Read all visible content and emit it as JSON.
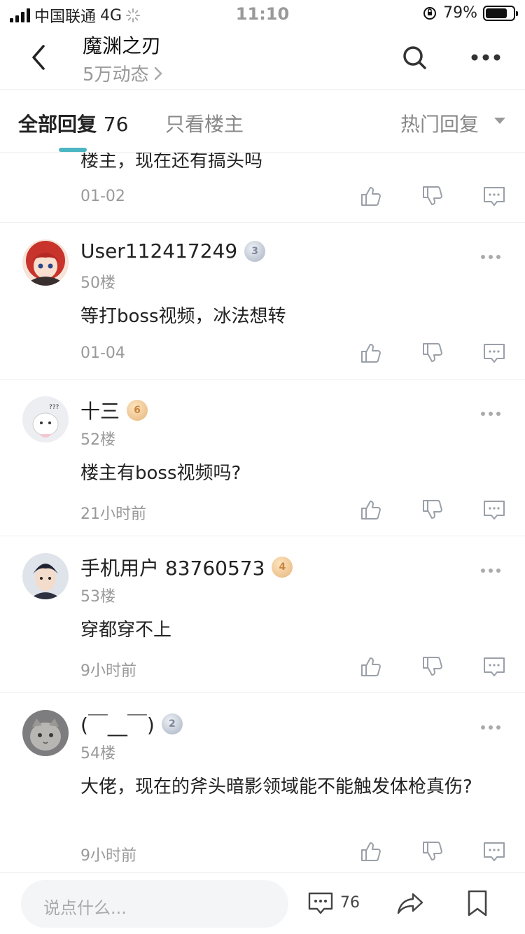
{
  "status_bar": {
    "carrier": "中国联通",
    "network": "4G",
    "time": "11:10",
    "battery": "79%",
    "battery_level": 0.79
  },
  "header": {
    "title": "魔渊之刃",
    "subtitle": "5万动态",
    "icons": [
      "back-icon",
      "search-icon",
      "more-icon"
    ]
  },
  "tabs": {
    "all_label": "全部回复",
    "all_count": "76",
    "owner_label": "只看楼主",
    "sort_label": "热门回复"
  },
  "posts": [
    {
      "content": "楼主，现在还有搞头吗",
      "time": "01-02"
    },
    {
      "username": "User112417249",
      "badge_level": "3",
      "badge_color": "#a8b2c2",
      "floor": "50楼",
      "content": "等打boss视频，冰法想转",
      "time": "01-04"
    },
    {
      "username": "十三",
      "badge_level": "6",
      "badge_color": "#e6b47a",
      "floor": "52楼",
      "content": "楼主有boss视频吗?",
      "time": "21小时前"
    },
    {
      "username": "手机用户 83760573",
      "badge_level": "4",
      "badge_color": "#e6b47a",
      "floor": "53楼",
      "content": "穿都穿不上",
      "time": "9小时前"
    },
    {
      "username": "(￣__￣)",
      "badge_level": "2",
      "badge_color": "#a8b2c2",
      "floor": "54楼",
      "content": "大佬，现在的斧头暗影领域能不能触发体枪真伤?",
      "time": "9小时前"
    }
  ],
  "bottom_bar": {
    "input_placeholder": "说点什么...",
    "comment_count": "76",
    "icons": [
      "comment-icon",
      "share-icon",
      "bookmark-icon"
    ]
  },
  "colors": {
    "accent": "#4cb6c4",
    "muted_text": "#999999",
    "icon_gray": "#9aa0a8"
  }
}
